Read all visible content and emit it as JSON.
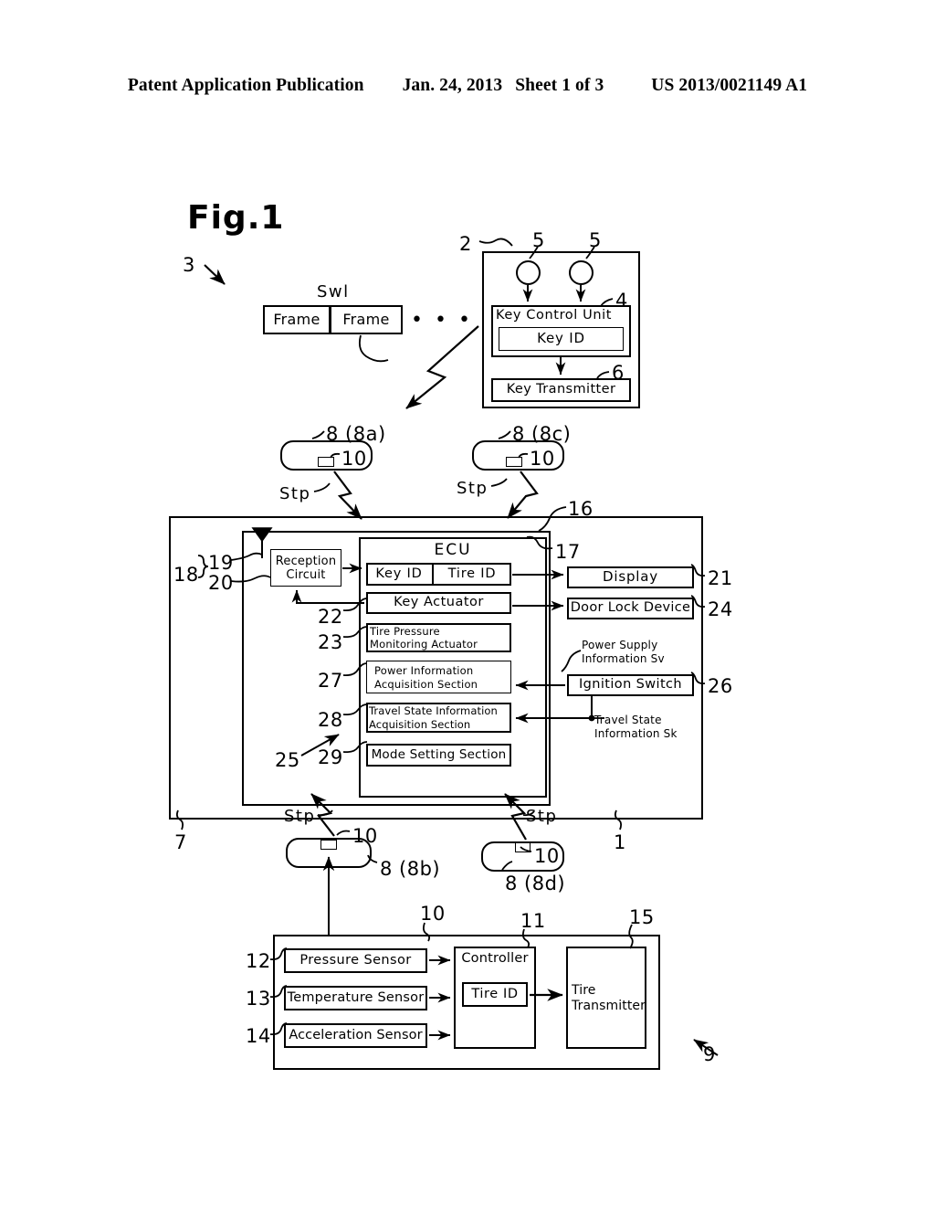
{
  "header": {
    "publication": "Patent Application Publication",
    "date": "Jan. 24, 2013",
    "sheet": "Sheet 1 of 3",
    "patent_number": "US 2013/0021149 A1"
  },
  "figure": {
    "title": "Fig.1"
  },
  "signal_frame": {
    "signal_label": "Swl",
    "frame1": "Frame",
    "frame2": "Frame",
    "ellipsis": "• • •"
  },
  "key_unit": {
    "key_control_unit": "Key Control Unit",
    "key_id": "Key ID",
    "key_transmitter": "Key Transmitter"
  },
  "ecu": {
    "title": "ECU",
    "key_id": "Key ID",
    "tire_id": "Tire ID",
    "key_actuator": "Key Actuator",
    "tire_pressure_monitoring_actuator": "Tire Pressure\nMonitoring Actuator",
    "power_information_acquisition_section": "Power Information\nAcquisition Section",
    "travel_state_information_acquisition_section": "Travel State Information\nAcquisition Section",
    "mode_setting_section": "Mode Setting Section",
    "reception_circuit": "Reception\nCircuit"
  },
  "vehicle_devices": {
    "display": "Display",
    "door_lock_device": "Door Lock Device",
    "ignition_switch": "Ignition Switch",
    "power_supply_information": "Power Supply\nInformation Sv",
    "travel_state_information": "Travel State\nInformation Sk"
  },
  "tire_modules": [
    {
      "ref": "8 (8a)",
      "inner_ref": "10",
      "stp": "Stp"
    },
    {
      "ref": "8 (8c)",
      "inner_ref": "10",
      "stp": "Stp"
    },
    {
      "ref": "8 (8b)",
      "inner_ref": "10",
      "stp": "Stp"
    },
    {
      "ref": "8 (8d)",
      "inner_ref": "10",
      "stp": "Stp"
    }
  ],
  "sensor_module": {
    "pressure_sensor": "Pressure Sensor",
    "temperature_sensor": "Temperature Sensor",
    "acceleration_sensor": "Acceleration Sensor",
    "controller": "Controller",
    "tire_id": "Tire ID",
    "tire_transmitter": "Tire\nTransmitter"
  },
  "refs": {
    "r1": "1",
    "r2": "2",
    "r3": "3",
    "r4": "4",
    "r5a": "5",
    "r5b": "5",
    "r6": "6",
    "r7": "7",
    "r9": "9",
    "r10_top": "10",
    "r11": "11",
    "r12": "12",
    "r13": "13",
    "r14": "14",
    "r15": "15",
    "r16": "16",
    "r17": "17",
    "r18": "18",
    "r19": "19",
    "r20": "20",
    "r21": "21",
    "r22": "22",
    "r23": "23",
    "r24": "24",
    "r25": "25",
    "r26": "26",
    "r27": "27",
    "r28": "28",
    "r29": "29"
  },
  "colors": {
    "ink": "#000000",
    "paper": "#ffffff"
  }
}
